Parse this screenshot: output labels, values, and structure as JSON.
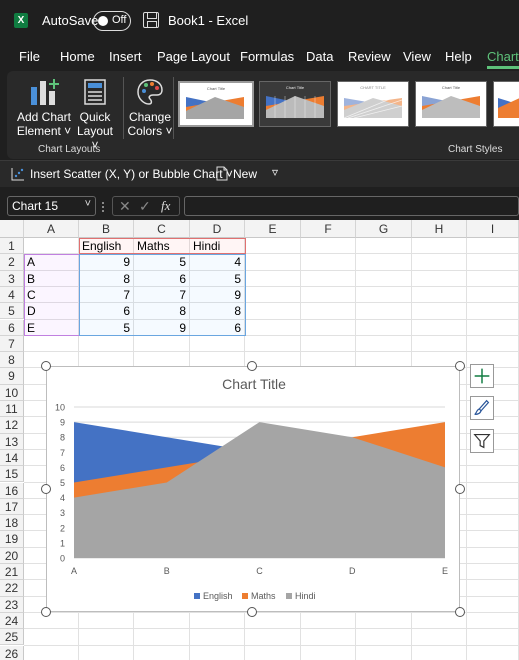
{
  "titlebar": {
    "autosave_label": "AutoSave",
    "autosave_state": "Off",
    "book_title": "Book1  -  Excel",
    "app_badge": "X"
  },
  "menu": [
    "File",
    "Home",
    "Insert",
    "Page Layout",
    "Formulas",
    "Data",
    "Review",
    "View",
    "Help",
    "Chart"
  ],
  "ribbon": {
    "add_chart_element": [
      "Add Chart",
      "Element ˅"
    ],
    "quick_layout": [
      "Quick",
      "Layout ˅"
    ],
    "change_colors": [
      "Change",
      "Colors ˅"
    ],
    "group_chart_layouts": "Chart Layouts",
    "group_chart_styles": "Chart Styles"
  },
  "qat": {
    "insert_scatter": "Insert Scatter (X, Y) or Bubble Chart ˅",
    "new": "New",
    "dropdown_glyph": "▿"
  },
  "formula": {
    "name_box": "Chart 15",
    "fx": "fx",
    "value": ""
  },
  "columns": [
    "A",
    "B",
    "C",
    "D",
    "E",
    "F",
    "G",
    "H",
    "I"
  ],
  "rows": [
    "1",
    "2",
    "3",
    "4",
    "5",
    "6",
    "7",
    "8",
    "9",
    "10",
    "11",
    "12",
    "13",
    "14",
    "15",
    "16",
    "17",
    "18",
    "19",
    "20",
    "21",
    "22",
    "23",
    "24",
    "25",
    "26"
  ],
  "table": {
    "headers": [
      "English",
      "Maths",
      "Hindi"
    ],
    "rows": [
      {
        "label": "A",
        "values": [
          9,
          5,
          4
        ]
      },
      {
        "label": "B",
        "values": [
          8,
          6,
          5
        ]
      },
      {
        "label": "C",
        "values": [
          7,
          7,
          9
        ]
      },
      {
        "label": "D",
        "values": [
          6,
          8,
          8
        ]
      },
      {
        "label": "E",
        "values": [
          5,
          9,
          6
        ]
      }
    ]
  },
  "chart_data": {
    "type": "area",
    "title": "Chart Title",
    "categories": [
      "A",
      "B",
      "C",
      "D",
      "E"
    ],
    "series": [
      {
        "name": "English",
        "values": [
          9,
          8,
          7,
          6,
          5
        ],
        "color": "#4472c4"
      },
      {
        "name": "Maths",
        "values": [
          5,
          6,
          7,
          8,
          9
        ],
        "color": "#ed7d31"
      },
      {
        "name": "Hindi",
        "values": [
          4,
          5,
          9,
          8,
          6
        ],
        "color": "#a5a5a5"
      }
    ],
    "ylim": [
      0,
      10
    ],
    "yticks": [
      0,
      1,
      2,
      3,
      4,
      5,
      6,
      7,
      8,
      9,
      10
    ],
    "grid": true,
    "legend": "bottom"
  },
  "side_buttons": [
    "plus-icon",
    "brush-icon",
    "filter-icon"
  ]
}
